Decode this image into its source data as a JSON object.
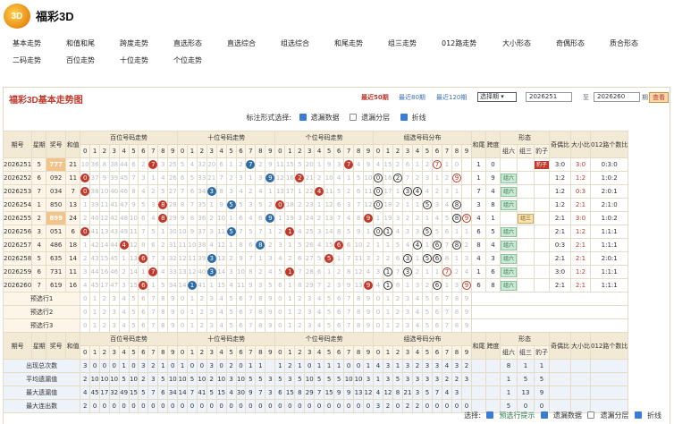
{
  "app": {
    "logo_text": "3D",
    "title": "福彩3D"
  },
  "nav": [
    "基本走势",
    "和值和尾",
    "跨度走势",
    "直选形态",
    "直选综合",
    "组选综合",
    "和尾走势",
    "组三走势",
    "012路走势",
    "大小形态",
    "奇偶形态",
    "质合形态",
    "二码走势",
    "百位走势",
    "十位走势",
    "个位走势"
  ],
  "panel": {
    "title": "福彩3D基本走势图",
    "recent": [
      "最近50期",
      "最近80期",
      "最近120期"
    ],
    "select_period": "选择期",
    "from": "2026251",
    "to_label": "至",
    "to": "2026260",
    "period_label": "期",
    "query": "查看",
    "display_label": "标注形式选择:",
    "options": [
      {
        "label": "遗漏数据",
        "checked": true
      },
      {
        "label": "遗漏分层",
        "checked": false
      },
      {
        "label": "折线",
        "checked": true
      }
    ]
  },
  "table": {
    "headers": {
      "issue": "期号",
      "week": "星期",
      "prize": "奖号",
      "sum": "和值",
      "hundreds": "百位号码走势",
      "tens": "十位号码走势",
      "units": "个位号码走势",
      "group": "组选号码分布",
      "tail": "和尾",
      "span": "跨度",
      "form": "形态",
      "form_subs": [
        "组六",
        "组三",
        "豹子"
      ],
      "odd_even": "奇偶比",
      "big_small": "大小比",
      "r012": "012路个数比"
    },
    "digits": [
      "0",
      "1",
      "2",
      "3",
      "4",
      "5",
      "6",
      "7",
      "8",
      "9"
    ],
    "rows": [
      {
        "issue": "2026251",
        "week": "5",
        "prize": "777",
        "sum": "21",
        "h": "10 36 8 38 44 6 2 ⑦ 3 25",
        "t": "5 4 32 20 6 1 2 ⑦ 2 9",
        "u": "11 15 5 20 1 9 3 ⑦ 4 9",
        "g": "4 15 2 6 1 2 ⑦ 1 0",
        "tail": "1",
        "span": "0",
        "form": "豹子",
        "oe": "3:0",
        "bs": "3:0",
        "r012": "0:3:0"
      },
      {
        "issue": "2026252",
        "week": "6",
        "prize": "092",
        "sum": "11",
        "h": "⓪ 37 9 39 45 7 3 1 4 26",
        "t": "6 5 33 21 7 2 3 1 3 ⑨",
        "u": "12 16 ② 21 2 10 4 1 5 10",
        "g": "⓪ 16 ② 7 2 3 1 2 ⑨",
        "tail": "1",
        "span": "9",
        "form": "组六",
        "oe": "1:2",
        "bs": "1:2",
        "r012": "1:0:2"
      },
      {
        "issue": "2026253",
        "week": "7",
        "prize": "034",
        "sum": "7",
        "h": "⓪ 38 10 40 46 8 4 2 5 27",
        "t": "7 6 34 ③ 8 3 4 2 4 1",
        "u": "13 17 1 22 ④ 11 5 2 6 11",
        "g": "⓪ 17 1 ③ ④ 4 2 3 1",
        "tail": "7",
        "span": "4",
        "form": "组六",
        "oe": "1:2",
        "bs": "0:3",
        "r012": "2:0:1"
      },
      {
        "issue": "2026254",
        "week": "1",
        "prize": "850",
        "sum": "13",
        "h": "1 39 11 41 47 9 5 3 ⑧ 28",
        "t": "8 7 35 1 9 ⑤ 5 3 5 2",
        "u": "⓪ 18 2 23 1 12 6 3 7 12",
        "g": "⓪ 18 2 1 1 ⑤ 3 4 ⑧",
        "tail": "3",
        "span": "8",
        "form": "组六",
        "oe": "1:2",
        "bs": "2:1",
        "r012": "2:1:0"
      },
      {
        "issue": "2026255",
        "week": "2",
        "prize": "899",
        "sum": "24",
        "h": "2 40 12 42 48 10 6 4 ⑧ 29",
        "t": "9 8 36 2 10 1 6 4 6 ⑨",
        "u": "1 19 3 24 2 13 7 4 8 ⑨",
        "g": "1 19 3 2 2 1 4 5 ⑧ ⑨",
        "tail": "4",
        "span": "1",
        "form": "组三",
        "oe": "2:1",
        "bs": "3:0",
        "r012": "1:0:2"
      },
      {
        "issue": "2026256",
        "week": "3",
        "prize": "051",
        "sum": "6",
        "h": "⓪ 41 13 43 49 11 7 5 1 30",
        "t": "10 9 37 3 11 ⑤ 7 5 7 1",
        "u": "2 ① 4 25 3 14 8 5 9 1",
        "g": "⓪ ① 4 3 3 ⑤ 5 6 1 1",
        "tail": "6",
        "span": "5",
        "form": "组六",
        "oe": "2:1",
        "bs": "1:2",
        "r012": "1:1:1"
      },
      {
        "issue": "2026257",
        "week": "4",
        "prize": "486",
        "sum": "18",
        "h": "1 42 14 44 ④ 12 8 6 2 31",
        "t": "11 10 38 4 12 1 8 6 ⑧ 2",
        "u": "3 1 5 26 4 15 ⑥ 6 10 2",
        "g": "1 1 5 4 ④ 1 ⑥ 7 ⑧ 2",
        "tail": "8",
        "span": "4",
        "form": "组六",
        "oe": "0:3",
        "bs": "2:1",
        "r012": "1:1:1"
      },
      {
        "issue": "2026258",
        "week": "5",
        "prize": "635",
        "sum": "14",
        "h": "2 43 15 45 1 13 ⑥ 7 3 32",
        "t": "12 11 39 ③ 13 2 9 7 1 3",
        "u": "4 2 6 27 5 ⑤ 1 7 11 3",
        "g": "2 2 6 ③ 1 ⑤ ⑥ 8 1 3",
        "tail": "4",
        "span": "3",
        "form": "组六",
        "oe": "2:1",
        "bs": "2:1",
        "r012": "2:0:1"
      },
      {
        "issue": "2026259",
        "week": "6",
        "prize": "731",
        "sum": "11",
        "h": "3 44 16 46 2 14 1 ⑦ 4 33",
        "t": "13 12 40 ③ 14 3 10 8 2 4",
        "u": "5 ① 7 28 6 1 2 8 12 4",
        "g": "3 ① 7 ③ 2 1 1 ⑦ 2 4",
        "tail": "1",
        "span": "6",
        "form": "组六",
        "oe": "3:0",
        "bs": "1:2",
        "r012": "1:1:1"
      },
      {
        "issue": "2026260",
        "week": "7",
        "prize": "619",
        "sum": "16",
        "h": "4 45 17 47 3 15 ⑥ 1 5 34",
        "t": "14 ① 41 1 15 4 11 9 3 5",
        "u": "6 1 8 29 7 2 3 9 13 ⑨",
        "g": "4 ① 8 1 3 2 ⑥ 1 3 ⑨",
        "tail": "6",
        "span": "8",
        "form": "组六",
        "oe": "2:1",
        "bs": "2:1",
        "r012": "1:1:1"
      }
    ],
    "preselect": [
      "预选行1",
      "预选行2",
      "预选行3"
    ],
    "stats_headers": {
      "issue": "期号",
      "week": "星期",
      "prize": "奖号",
      "sum": "和值",
      "tail": "和尾",
      "span": "跨度",
      "form": "形态",
      "form_subs": [
        "组六",
        "组三",
        "豹子"
      ],
      "odd_even": "奇偶比",
      "big_small": "大小比",
      "r012": "012路个数比"
    },
    "stats": [
      {
        "label": "出现总次数",
        "h": "3 0 0 0 1 0 3 2 1 0",
        "t": "1 0 0 3 0 2 0 1 1",
        "u": "1 2 1 0 1 1 1 0 0 1",
        "g": "4 3 1 3 2 3 3 4 3 2",
        "form": "8 1 1"
      },
      {
        "label": "平均遗漏值",
        "h": "2 10 10 10 5 10 2 3 5 10",
        "t": "10 5 10 2 10 3 10 5 5 3",
        "u": "5 3 5 10 5 5 5 10 10 3",
        "g": "1 3 5 3 3 3 3 2 2 3",
        "form": "1 5 5"
      },
      {
        "label": "最大遗漏值",
        "h": "4 45 17 32 49 15 5 7 6 34",
        "t": "14 7 41 5 15 4 30 9 7 3",
        "u": "6 15 8 29 7 15 9 9 13 12",
        "g": "4 12 8 21 3 5 7 4 3",
        "form": "1 13 9"
      },
      {
        "label": "最大连出数",
        "h": "2 0 0 0 0 0 0 0 0 0",
        "t": "0 0 0 0 0 0 0 0 0 0",
        "u": "0 0 0 0 0 0 0 0 0 0",
        "g": "3 2 0 2 2 0 0 0 0 0",
        "form": "5 0 0"
      }
    ]
  },
  "footer": {
    "label": "选择:",
    "options": [
      {
        "label": "预选行提示",
        "checked": true
      },
      {
        "label": "遗漏数据",
        "checked": true
      },
      {
        "label": "遗漏分层",
        "checked": false
      },
      {
        "label": "折线",
        "checked": true
      }
    ]
  },
  "colors": {
    "accent": "#c0392b",
    "blue_ball": "#2e6da4",
    "header_bg": "#f3ead6"
  }
}
